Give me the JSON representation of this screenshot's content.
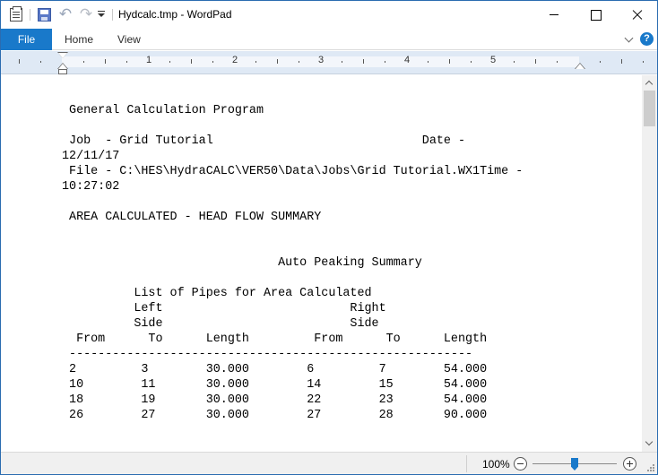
{
  "window": {
    "title": "Hydcalc.tmp - WordPad"
  },
  "quick_access": {
    "icons": [
      "save-icon",
      "undo-icon",
      "redo-icon",
      "customize-dropdown-icon"
    ]
  },
  "ribbon": {
    "tabs": [
      {
        "label": "File"
      },
      {
        "label": "Home"
      },
      {
        "label": "View"
      }
    ],
    "help_glyph": "?"
  },
  "ruler": {
    "numbers": [
      "1",
      "2",
      "3",
      "4",
      "5"
    ]
  },
  "document": {
    "lines": [
      " General Calculation Program",
      "",
      " Job  - Grid Tutorial                             Date -",
      "12/11/17",
      " File - C:\\HES\\HydraCALC\\VER50\\Data\\Jobs\\Grid Tutorial.WX1Time -",
      "10:27:02",
      "",
      " AREA CALCULATED - HEAD FLOW SUMMARY",
      "",
      "",
      "                              Auto Peaking Summary",
      "",
      "          List of Pipes for Area Calculated",
      "          Left                          Right",
      "          Side                          Side",
      "  From      To      Length         From      To      Length",
      " --------------------------------------------------------",
      " 2         3        30.000        6         7        54.000",
      " 10        11       30.000        14        15       54.000",
      " 18        19       30.000        22        23       54.000",
      " 26        27       30.000        27        28       90.000"
    ]
  },
  "statusbar": {
    "zoom": "100%",
    "zoom_value_percent": 100
  }
}
